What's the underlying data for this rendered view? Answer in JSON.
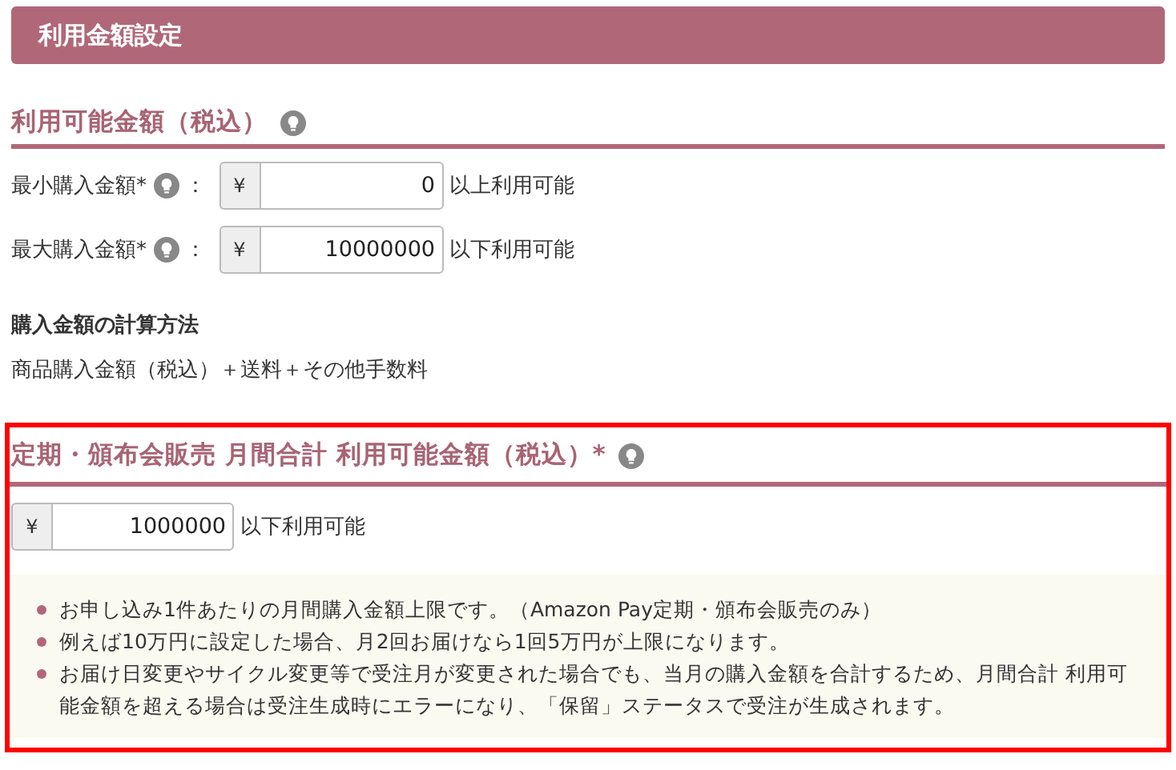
{
  "header": {
    "title": "利用金額設定"
  },
  "available_amount": {
    "title": "利用可能金額（税込）",
    "rows": [
      {
        "label": "最小購入金額*",
        "separator": "：",
        "currency": "¥",
        "value": "0",
        "suffix": "以上利用可能"
      },
      {
        "label": "最大購入金額*",
        "separator": "：",
        "currency": "¥",
        "value": "10000000",
        "suffix": "以下利用可能"
      }
    ],
    "calc_heading": "購入金額の計算方法",
    "calc_text": "商品購入金額（税込）＋送料＋その他手数料"
  },
  "monthly_section": {
    "highlighted": true,
    "title": "定期・頒布会販売 月間合計 利用可能金額（税込）*",
    "currency": "¥",
    "value": "1000000",
    "suffix": "以下利用可能",
    "notes": [
      "お申し込み1件あたりの月間購入金額上限です。（Amazon Pay定期・頒布会販売のみ）",
      "例えば10万円に設定した場合、月2回お届けなら1回5万円が上限になります。",
      "お届け日変更やサイクル変更等で受注月が変更された場合でも、当月の購入金額を合計するため、月間合計 利用可能金額を超える場合は受注生成時にエラーになり、「保留」ステータスで受注が生成されます。"
    ]
  }
}
